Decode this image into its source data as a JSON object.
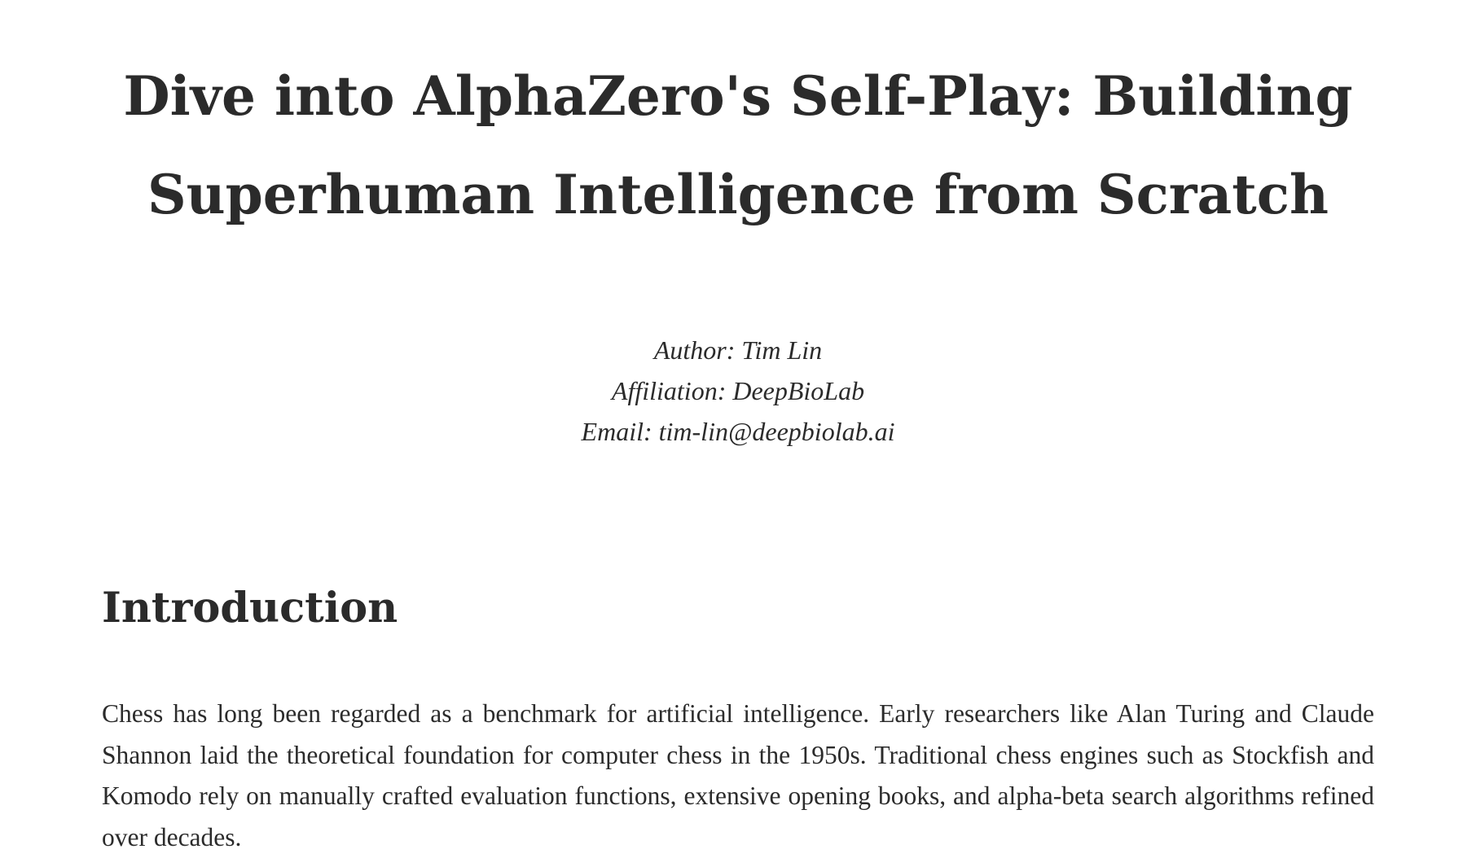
{
  "document": {
    "title": "Dive into AlphaZero's Self-Play: Building Superhuman Intelligence from Scratch",
    "author": "Author: Tim Lin",
    "affiliation": "Affiliation: DeepBioLab",
    "email": "Email: tim-lin@deepbiolab.ai"
  },
  "sections": [
    {
      "heading": "Introduction",
      "paragraph": "Chess has long been regarded as a benchmark for artificial intelligence. Early researchers like Alan Turing and Claude Shannon laid the theoretical foundation for computer chess in the 1950s. Traditional chess engines such as Stockfish and Komodo rely on manually crafted evaluation functions, extensive opening books, and alpha-beta search algorithms refined over decades."
    }
  ],
  "colors": {
    "text": "#2b2b2b",
    "background": "#ffffff"
  }
}
